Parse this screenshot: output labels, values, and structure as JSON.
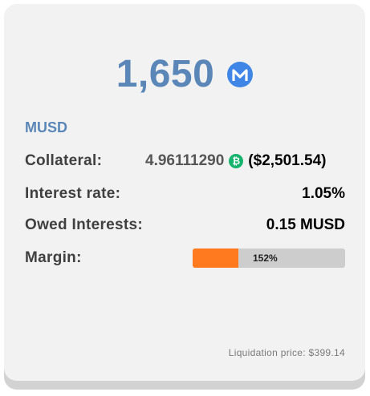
{
  "position": {
    "amount": "1,650",
    "token_icon": "musd-m-icon",
    "symbol": "MUSD"
  },
  "details": {
    "collateral": {
      "label": "Collateral:",
      "amount": "4.96111290",
      "icon": "bitcoin-icon",
      "icon_glyph": "₿",
      "usd": "($2,501.54)"
    },
    "interest_rate": {
      "label": "Interest rate:",
      "value": "1.05%"
    },
    "owed_interests": {
      "label": "Owed Interests:",
      "value": "0.15 MUSD"
    },
    "margin": {
      "label": "Margin:",
      "value": "152%",
      "fill_fraction": 0.3
    }
  },
  "liquidation_price": "Liquidation price: $399.14",
  "colors": {
    "accent": "#5b87b8",
    "token": "#3f86e6",
    "bitcoin": "#16b36e",
    "margin_fill": "#ff7a1f",
    "margin_track": "#cdcdcd"
  }
}
